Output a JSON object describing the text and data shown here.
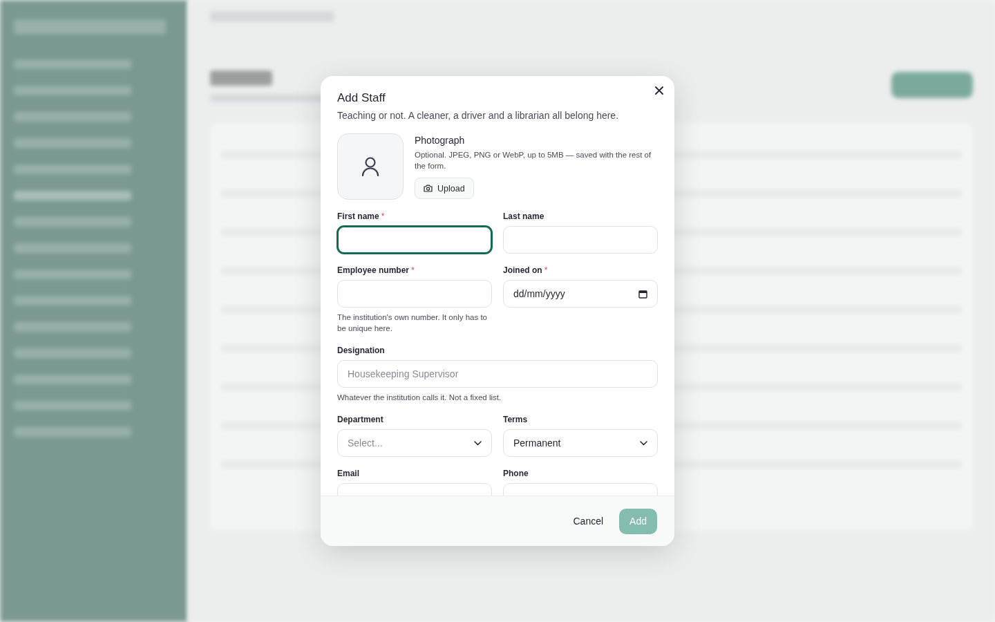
{
  "dialog": {
    "title": "Add Staff",
    "subtitle": "Teaching or not. A cleaner, a driver and a librarian all belong here.",
    "photo": {
      "title": "Photograph",
      "hint": "Optional. JPEG, PNG or WebP, up to 5MB — saved with the rest of the form.",
      "button": "Upload"
    },
    "rows": [
      [
        {
          "label": "First name",
          "required_mark": "*",
          "kind": "text",
          "focused": true
        },
        {
          "label": "Last name",
          "kind": "text",
          "focused": false
        }
      ],
      [
        {
          "label": "Employee number",
          "required_mark": "*",
          "kind": "text",
          "focused": false,
          "hint": "The institution's own number. It only has to be unique here."
        },
        {
          "label": "Joined on",
          "required_mark": "*",
          "kind": "date",
          "placeholder": "dd/mm/yyyy",
          "focused": false
        }
      ],
      [
        {
          "label": "Designation",
          "kind": "text",
          "placeholder": "Housekeeping Supervisor",
          "focused": false,
          "hint": "Whatever the institution calls it. Not a fixed list."
        }
      ],
      [
        {
          "label": "Department",
          "kind": "select",
          "placeholder": "Select...",
          "focused": false
        },
        {
          "label": "Terms",
          "kind": "select",
          "value": "Permanent",
          "focused": false
        }
      ],
      [
        {
          "label": "Email",
          "kind": "text",
          "focused": false
        },
        {
          "label": "Phone",
          "kind": "text",
          "focused": false
        }
      ]
    ],
    "buttons": [
      {
        "label": "Cancel",
        "kind": "secondary",
        "disabled": false
      },
      {
        "label": "Add",
        "kind": "primary",
        "disabled": true
      }
    ]
  }
}
